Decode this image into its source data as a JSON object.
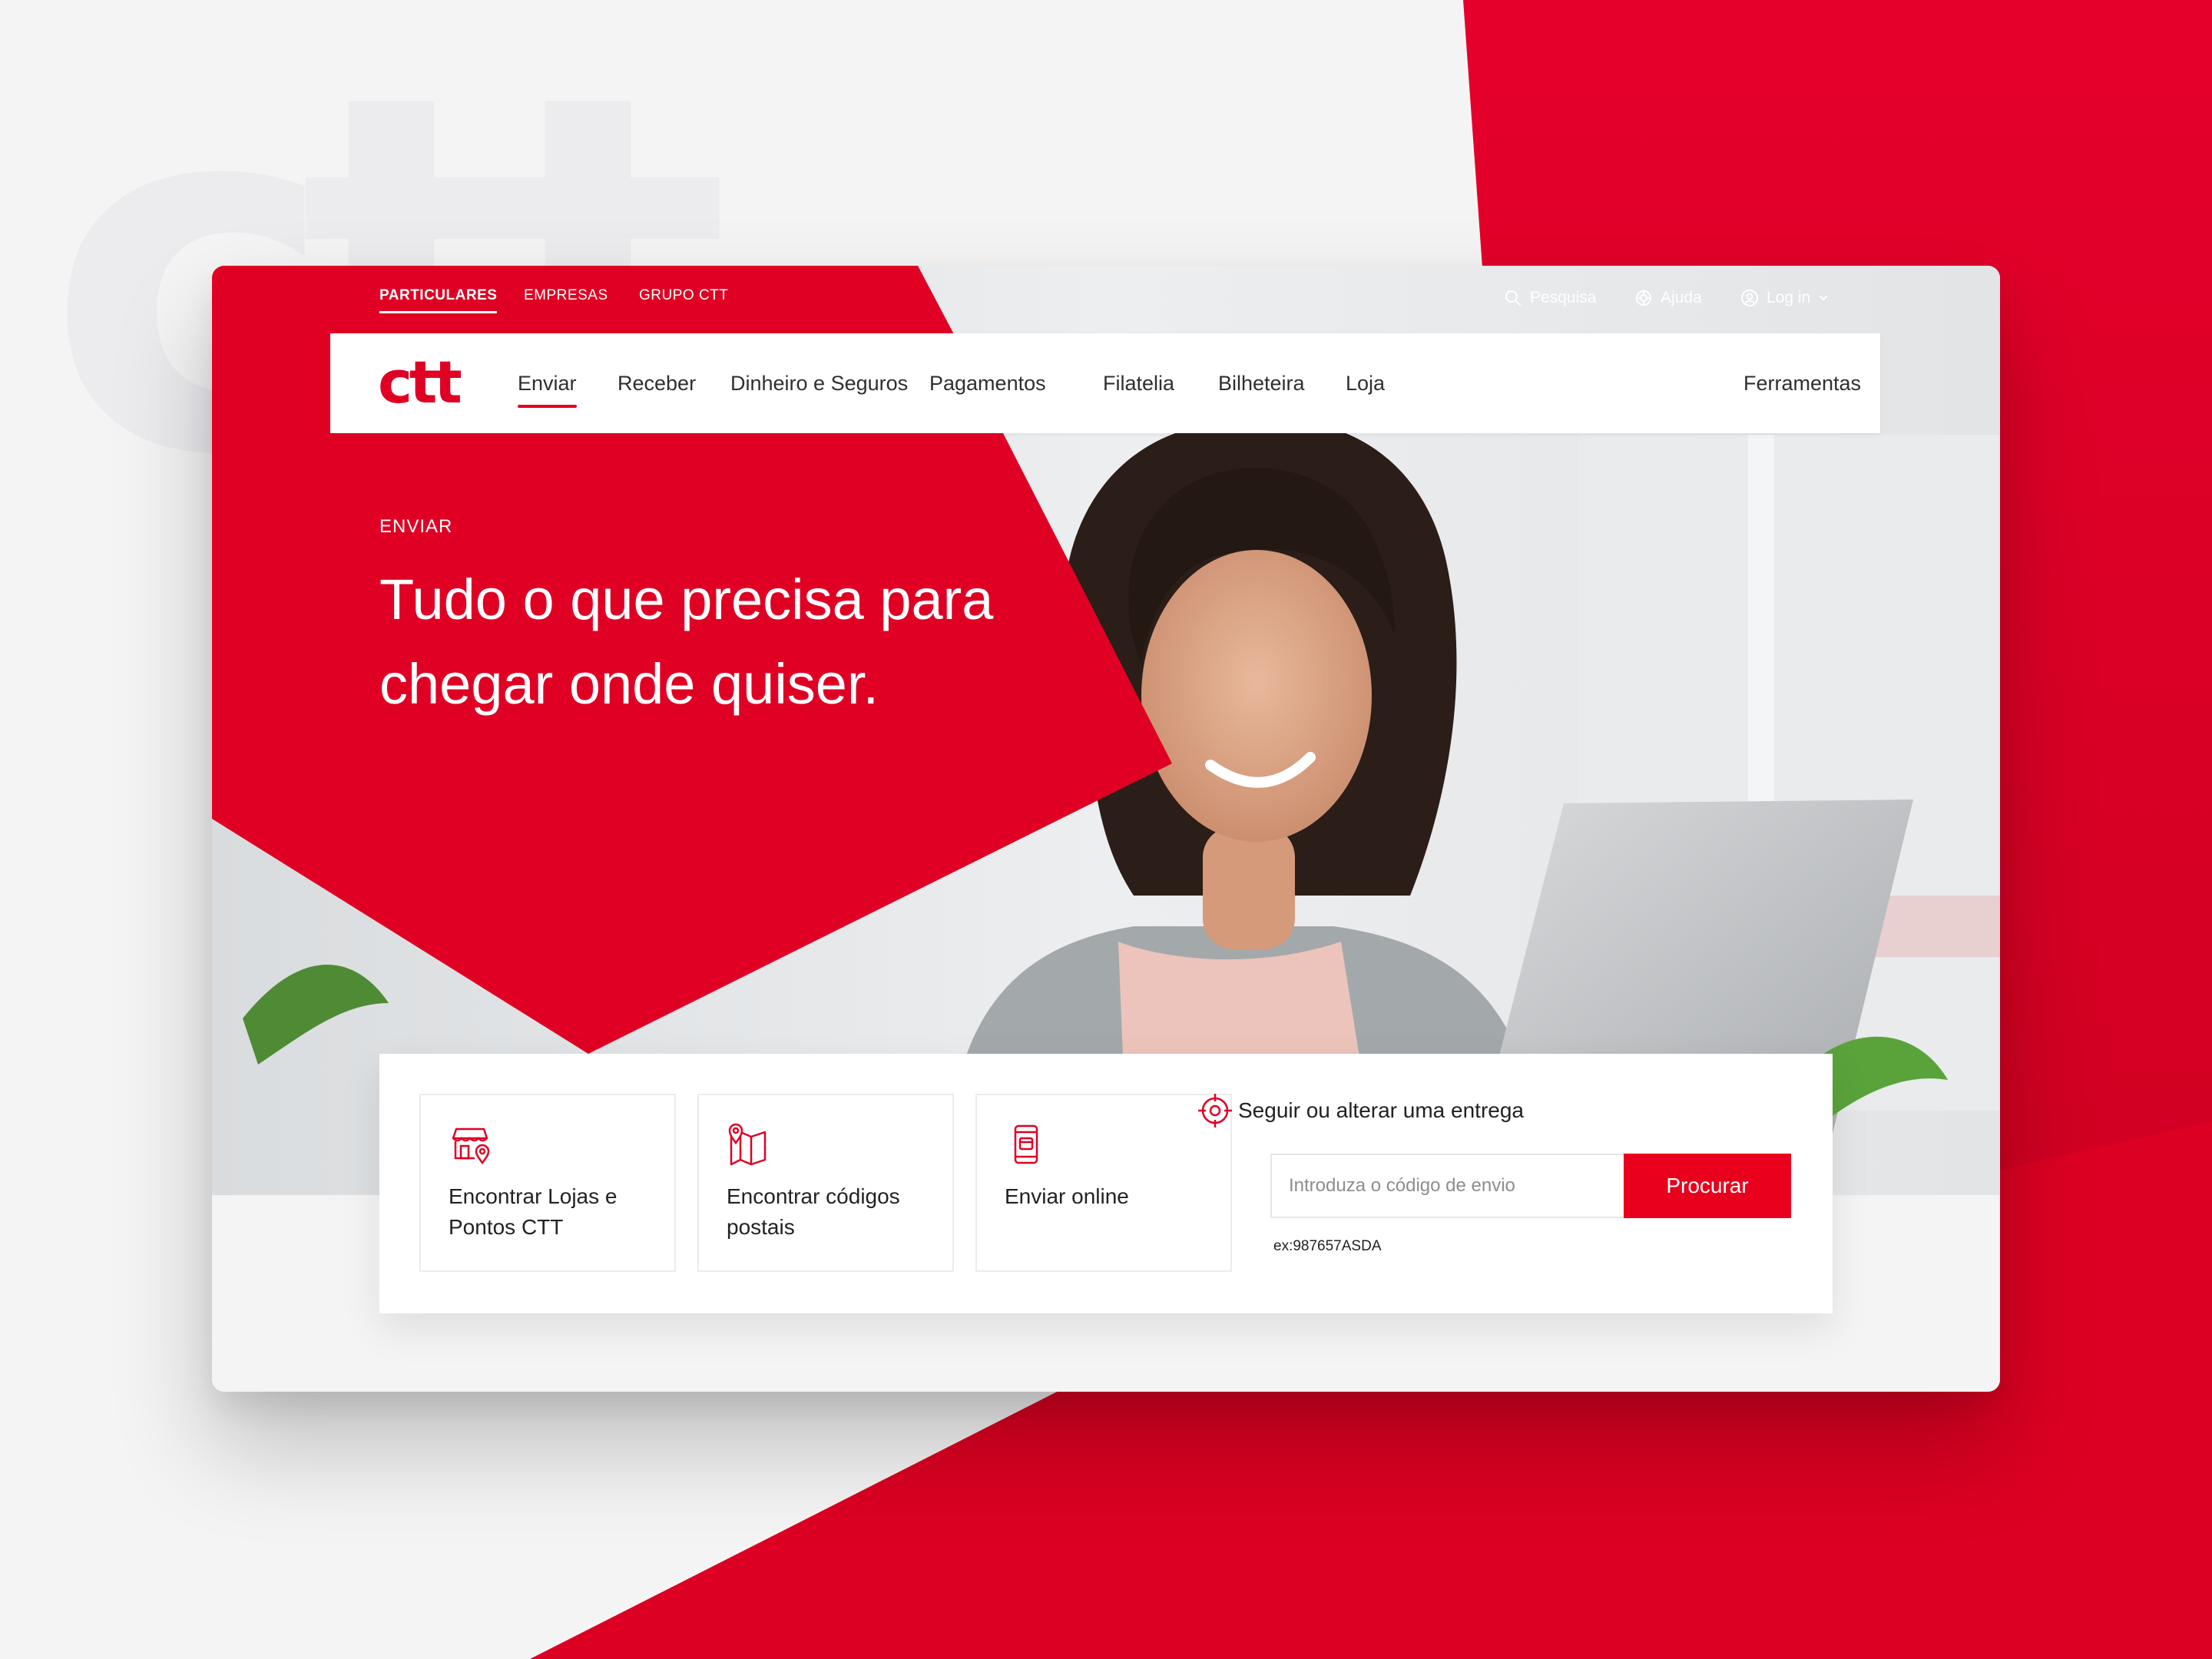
{
  "brand": {
    "logo_text": "ctt",
    "primary_color": "#df0024",
    "background_mark": "ctt"
  },
  "segments": [
    {
      "label": "PARTICULARES",
      "active": true
    },
    {
      "label": "EMPRESAS",
      "active": false
    },
    {
      "label": "GRUPO CTT",
      "active": false
    }
  ],
  "utility": {
    "search": {
      "label": "Pesquisa",
      "icon": "search-icon"
    },
    "help": {
      "label": "Ajuda",
      "icon": "lifebuoy-icon"
    },
    "login": {
      "label": "Log in",
      "icon": "user-icon"
    }
  },
  "nav": {
    "items": [
      {
        "label": "Enviar",
        "active": true
      },
      {
        "label": "Receber"
      },
      {
        "label": "Dinheiro e Seguros"
      },
      {
        "label": "Pagamentos"
      },
      {
        "label": "Filatelia"
      },
      {
        "label": "Bilheteira"
      },
      {
        "label": "Loja"
      }
    ],
    "tools": "Ferramentas"
  },
  "hero": {
    "eyebrow": "ENVIAR",
    "headline_line1": "Tudo o que precisa para",
    "headline_line2": "chegar onde quiser."
  },
  "quick_actions": [
    {
      "label": "Encontrar Lojas e Pontos CTT",
      "icon": "store-location-icon"
    },
    {
      "label": "Encontrar códigos postais",
      "icon": "map-pin-icon"
    },
    {
      "label": "Enviar online",
      "icon": "mobile-phone-icon"
    }
  ],
  "tracking": {
    "title": "Seguir ou alterar uma entrega",
    "icon": "target-icon",
    "placeholder": "Introduza o código de envio",
    "button": "Procurar",
    "example": "ex:987657ASDA"
  }
}
